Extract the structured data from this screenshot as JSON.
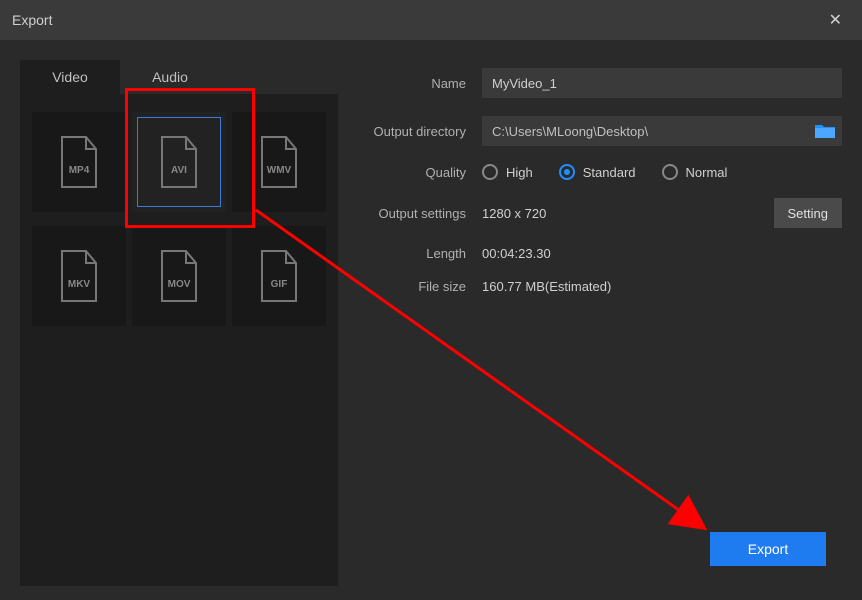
{
  "window": {
    "title": "Export"
  },
  "tabs": {
    "video": "Video",
    "audio": "Audio"
  },
  "formats": {
    "mp4": "MP4",
    "avi": "AVI",
    "wmv": "WMV",
    "mkv": "MKV",
    "mov": "MOV",
    "gif": "GIF"
  },
  "labels": {
    "name": "Name",
    "outputDir": "Output directory",
    "quality": "Quality",
    "outputSettings": "Output settings",
    "length": "Length",
    "fileSize": "File size"
  },
  "values": {
    "name": "MyVideo_1",
    "outputDir": "C:\\Users\\MLoong\\Desktop\\",
    "resolution": "1280 x 720",
    "length": "00:04:23.30",
    "fileSize": "160.77 MB(Estimated)"
  },
  "quality": {
    "high": "High",
    "standard": "Standard",
    "normal": "Normal",
    "selected": "standard"
  },
  "buttons": {
    "setting": "Setting",
    "export": "Export"
  }
}
